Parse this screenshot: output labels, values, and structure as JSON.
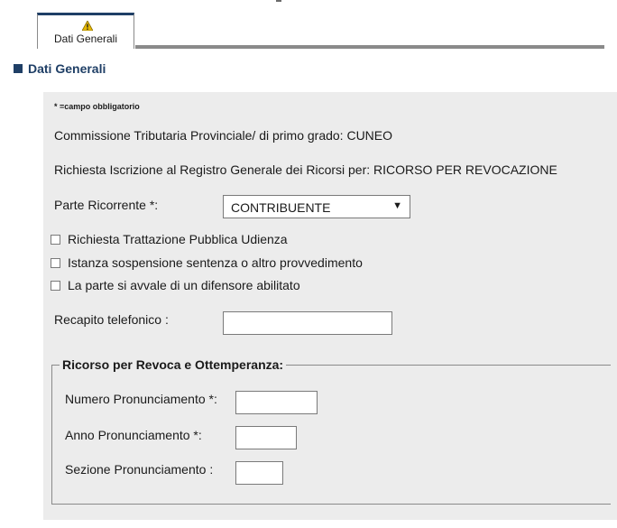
{
  "tabs": [
    {
      "label": "Dati Generali",
      "icon": "warning-icon"
    }
  ],
  "section": {
    "title": "Dati Generali"
  },
  "form": {
    "required_note": "* =campo obbligatorio",
    "commissione": "Commissione Tributaria Provinciale/ di primo grado: CUNEO",
    "richiesta": "Richiesta Iscrizione al Registro Generale dei Ricorsi per: RICORSO PER REVOCAZIONE",
    "parte_ricorrente": {
      "label": "Parte Ricorrente *:",
      "value": "CONTRIBUENTE",
      "arrow": "▼"
    },
    "checkboxes": [
      {
        "label": "Richiesta Trattazione Pubblica Udienza",
        "checked": false
      },
      {
        "label": "Istanza sospensione sentenza o altro provvedimento",
        "checked": false
      },
      {
        "label": "La parte si avvale di un difensore abilitato",
        "checked": false
      }
    ],
    "recapito": {
      "label": "Recapito telefonico  :",
      "value": ""
    }
  },
  "ricorso": {
    "legend": "Ricorso per Revoca e Ottemperanza:",
    "numero": {
      "label": "Numero Pronunciamento *:",
      "value": ""
    },
    "anno": {
      "label": "Anno Pronunciamento *:",
      "value": ""
    },
    "sezione": {
      "label": "Sezione Pronunciamento :",
      "value": ""
    }
  },
  "colors": {
    "accent": "#1f3f66",
    "panel_bg": "#ececec",
    "warning": "#e6b800"
  }
}
